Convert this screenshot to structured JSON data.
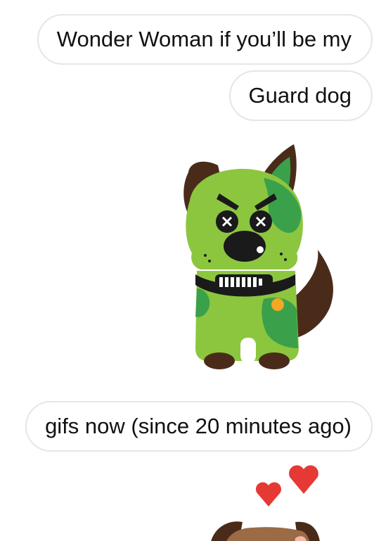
{
  "conversation": {
    "messages": [
      {
        "type": "text",
        "text": "Wonder Woman if you’ll be my"
      },
      {
        "type": "text",
        "text": "Guard dog"
      },
      {
        "type": "sticker",
        "icon": "angry-green-dog-sticker"
      },
      {
        "type": "text",
        "text": "gifs now (since 20 minutes ago)"
      },
      {
        "type": "sticker",
        "icon": "dog-with-hearts-sticker"
      }
    ]
  },
  "colors": {
    "bubble_border": "#e6e6e6",
    "dog_green": "#8cc63f",
    "dog_dark_green": "#3aa14a",
    "dog_brown": "#4a2b1a",
    "heart_red": "#e53935",
    "tag_orange": "#f5a623"
  }
}
